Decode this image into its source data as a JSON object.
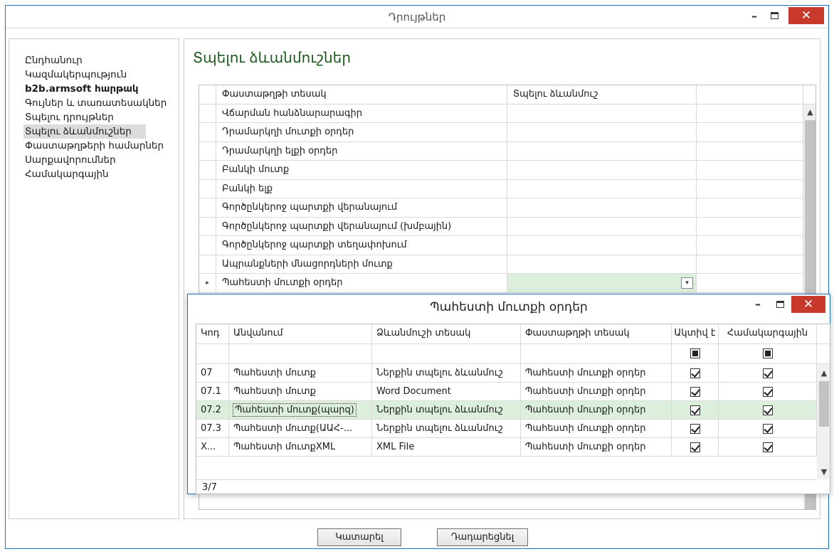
{
  "window": {
    "title": "Դրույթներ"
  },
  "sidebar": {
    "items": [
      {
        "label": "Ընդհանուր"
      },
      {
        "label": "Կազմակերպություն"
      },
      {
        "label": "b2b.armsoft հարթակ"
      },
      {
        "label": "Գույներ և տառատեսակներ"
      },
      {
        "label": "Տպելու դրույթներ"
      },
      {
        "label": "Տպելու ձևանմուշներ"
      },
      {
        "label": "Փաստաթղթերի համարներ"
      },
      {
        "label": "Սարքավորումներ"
      },
      {
        "label": "Համակարգային"
      }
    ],
    "selected_index": 5
  },
  "main": {
    "title": "Տպելու ձևանմուշներ",
    "columns": [
      "Փաստաթղթի տեսակ",
      "Տպելու ձևանմուշ"
    ],
    "rows": [
      "Վճարման հանձնարարագիր",
      "Դրամարկղի մուտքի օրդեր",
      "Դրամարկղի ելքի օրդեր",
      "Բանկի մուտք",
      "Բանկի ելք",
      "Գործընկերոջ պարտքի վերանայում",
      "Գործընկերոջ պարտքի վերանայում (խմբային)",
      "Գործընկերոջ պարտքի տեղափոխում",
      "Ապրանքների մնացորդների մուտք",
      "Պահեստի մուտքի օրդեր"
    ],
    "current_row_index": 9,
    "current_marker": "▸",
    "dropdown_icon": "chevron-down-icon"
  },
  "buttons": {
    "ok": "Կատարել",
    "cancel": "Դադարեցնել"
  },
  "popup": {
    "title": "Պահեստի մուտքի օրդեր",
    "columns": [
      "Կոդ",
      "Անվանում",
      "Ձևանմուշի տեսակ",
      "Փաստաթղթի տեսակ",
      "Ակտիվ է",
      "Համակարգային"
    ],
    "filter_row": {
      "active": "indeterminate",
      "system": "indeterminate"
    },
    "rows": [
      {
        "code": "07",
        "name": "Պահեստի մուտք",
        "template_type": "Ներքին տպելու ձևանմուշ",
        "doc_type": "Պահեստի մուտքի օրդեր",
        "active": true,
        "system": true
      },
      {
        "code": "07.1",
        "name": "Պահեստի մուտք",
        "template_type": "Word Document",
        "doc_type": "Պահեստի մուտքի օրդեր",
        "active": true,
        "system": true
      },
      {
        "code": "07.2",
        "name": "Պահեստի մուտք(պարզ)",
        "template_type": "Ներքին տպելու ձևանմուշ",
        "doc_type": "Պահեստի մուտքի օրդեր",
        "active": true,
        "system": true
      },
      {
        "code": "07.3",
        "name": "Պահեստի մուտք(ԱԱՀ-...",
        "template_type": "Ներքին տպելու ձևանմուշ",
        "doc_type": "Պահեստի մուտքի օրդեր",
        "active": true,
        "system": true
      },
      {
        "code": "X...",
        "name": "Պահեստի մուտքXML",
        "template_type": "XML File",
        "doc_type": "Պահեստի մուտքի օրդեր",
        "active": true,
        "system": true
      }
    ],
    "selected_row_index": 2,
    "record_counter": "3/7"
  }
}
